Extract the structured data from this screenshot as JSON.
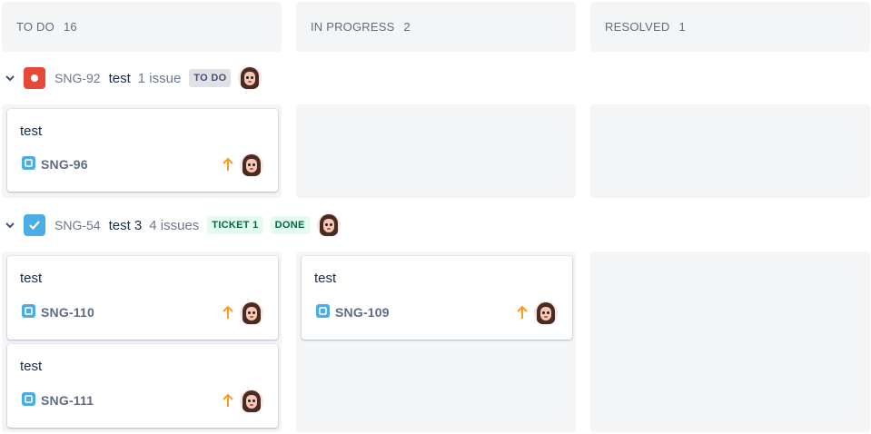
{
  "columns": [
    {
      "name": "TO DO",
      "count": "16"
    },
    {
      "name": "IN PROGRESS",
      "count": "2"
    },
    {
      "name": "RESOLVED",
      "count": "1"
    }
  ],
  "lanes": [
    {
      "key": "SNG-92",
      "summary": "test",
      "issues": "1 issue",
      "lozenges": [
        "TO DO"
      ],
      "type_icon": "bug-icon",
      "type_color": "#e5493a"
    },
    {
      "key": "SNG-54",
      "summary": "test 3",
      "issues": "4 issues",
      "lozenges": [
        "TICKET 1",
        "DONE"
      ],
      "type_icon": "task-checkbox-icon",
      "type_color": "#4bade8"
    }
  ],
  "cards": {
    "lane0_todo": [
      {
        "title": "test",
        "key": "SNG-96"
      }
    ],
    "lane1_todo": [
      {
        "title": "test",
        "key": "SNG-110"
      },
      {
        "title": "test",
        "key": "SNG-111"
      }
    ],
    "lane1_inprogress": [
      {
        "title": "test",
        "key": "SNG-109"
      }
    ]
  },
  "colors": {
    "column_bg": "#f4f5f7",
    "story_icon": "#4bade8",
    "priority_high": "#ff991f",
    "bug_icon": "#e5493a"
  }
}
